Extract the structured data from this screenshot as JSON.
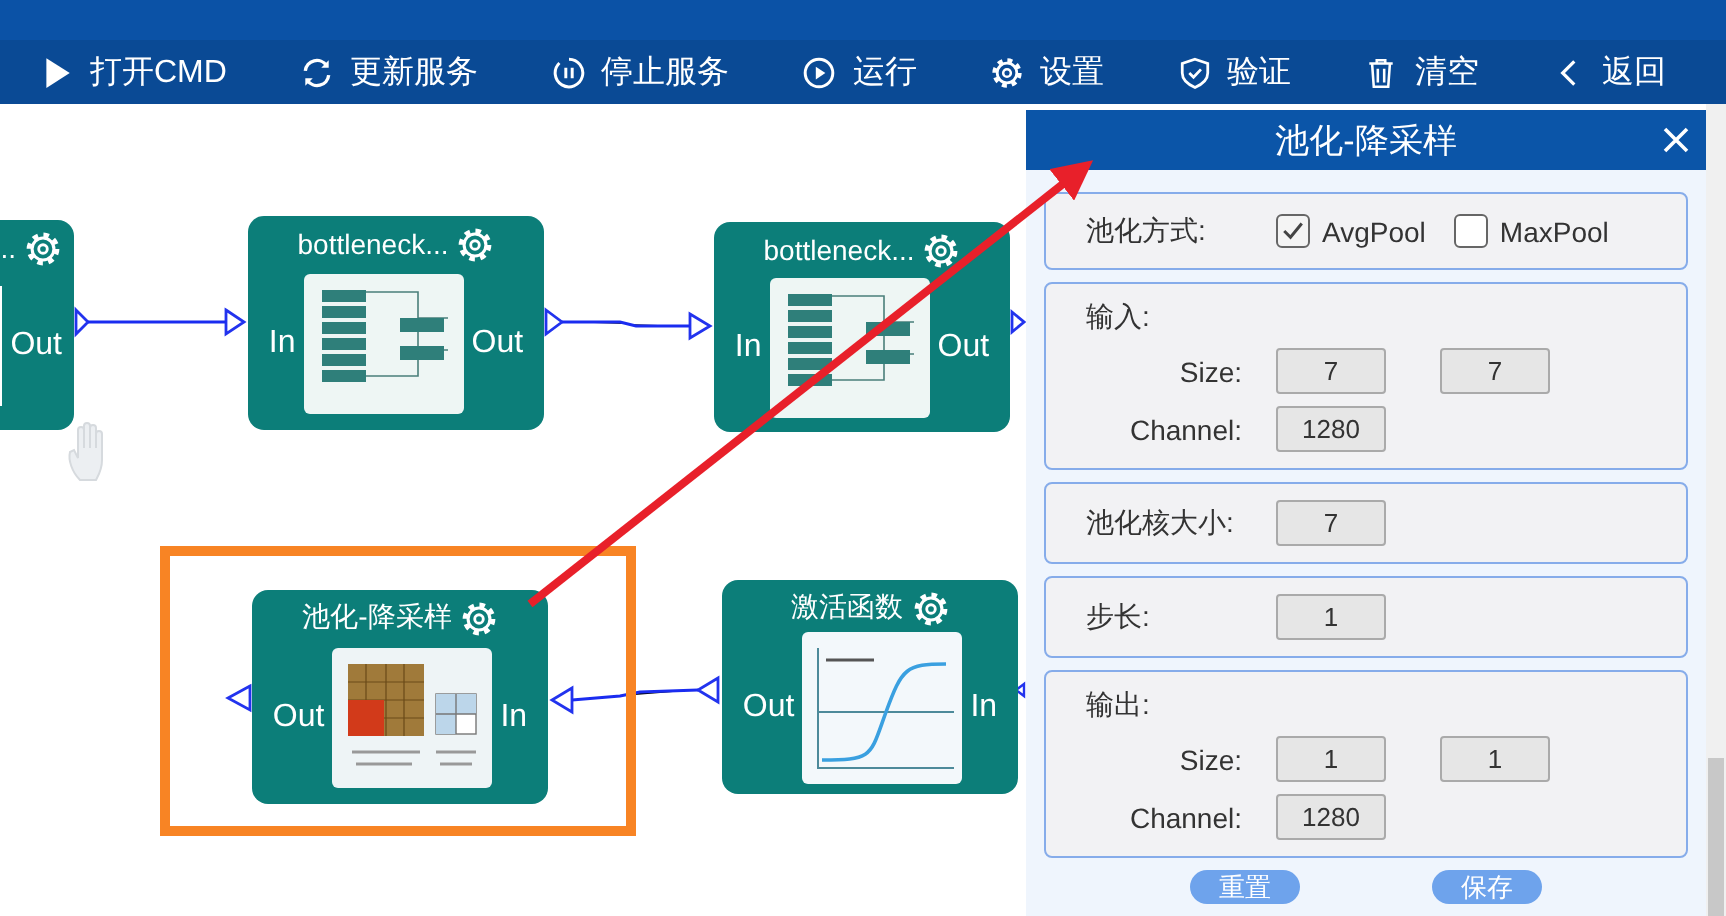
{
  "toolbar": {
    "items": [
      {
        "label": "打开CMD"
      },
      {
        "label": "更新服务"
      },
      {
        "label": "停止服务"
      },
      {
        "label": "运行"
      },
      {
        "label": "设置"
      },
      {
        "label": "验证"
      },
      {
        "label": "清空"
      },
      {
        "label": "返回"
      }
    ]
  },
  "canvas": {
    "nodes": [
      {
        "kind": "partial",
        "title": "...",
        "right_port": "Out"
      },
      {
        "kind": "bottleneck",
        "title": "bottleneck...",
        "left_port": "In",
        "right_port": "Out"
      },
      {
        "kind": "bottleneck",
        "title": "bottleneck...",
        "left_port": "In",
        "right_port": "Out"
      },
      {
        "kind": "pooling",
        "title": "池化-降采样",
        "left_port": "Out",
        "right_port": "In"
      },
      {
        "kind": "activation",
        "title": "激活函数",
        "left_port": "Out",
        "right_port": "In"
      }
    ]
  },
  "panel": {
    "title": "池化-降采样",
    "pool_type": {
      "label": "池化方式:",
      "options": [
        {
          "label": "AvgPool",
          "checked": true
        },
        {
          "label": "MaxPool",
          "checked": false
        }
      ]
    },
    "input": {
      "label": "输入:",
      "size_label": "Size:",
      "size": [
        "7",
        "7"
      ],
      "channel_label": "Channel:",
      "channel": "1280"
    },
    "kernel": {
      "label": "池化核大小:",
      "value": "7"
    },
    "stride": {
      "label": "步长:",
      "value": "1"
    },
    "output": {
      "label": "输出:",
      "size_label": "Size:",
      "size": [
        "1",
        "1"
      ],
      "channel_label": "Channel:",
      "channel": "1280"
    },
    "buttons": [
      "重置",
      "保存"
    ]
  }
}
